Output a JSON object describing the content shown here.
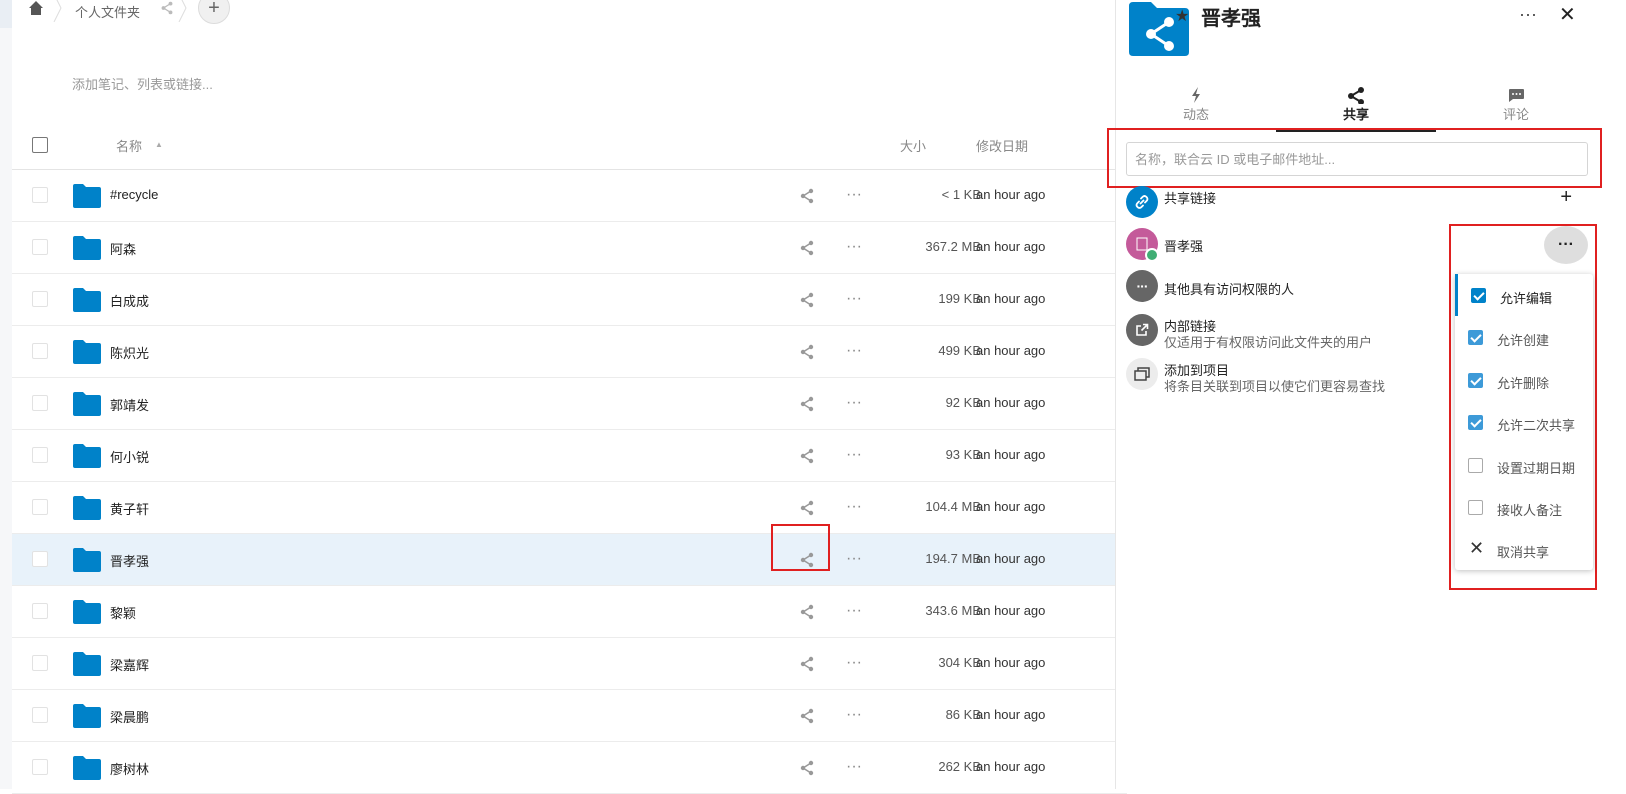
{
  "breadcrumb": {
    "label": "个人文件夹",
    "add_label": "+"
  },
  "notes_placeholder": "添加笔记、列表或链接...",
  "table": {
    "col_name": "名称",
    "col_size": "大小",
    "col_modified": "修改日期",
    "more_glyph": "···",
    "rows": [
      {
        "name": "#recycle",
        "size": "< 1 KB",
        "modified": "an hour ago"
      },
      {
        "name": "阿森",
        "size": "367.2 MB",
        "modified": "an hour ago"
      },
      {
        "name": "白成成",
        "size": "199 KB",
        "modified": "an hour ago"
      },
      {
        "name": "陈炽光",
        "size": "499 KB",
        "modified": "an hour ago"
      },
      {
        "name": "郭靖发",
        "size": "92 KB",
        "modified": "an hour ago"
      },
      {
        "name": "何小锐",
        "size": "93 KB",
        "modified": "an hour ago"
      },
      {
        "name": "黄子轩",
        "size": "104.4 MB",
        "modified": "an hour ago"
      },
      {
        "name": "晋孝强",
        "size": "194.7 MB",
        "modified": "an hour ago",
        "selected": true
      },
      {
        "name": "黎颖",
        "size": "343.6 MB",
        "modified": "an hour ago"
      },
      {
        "name": "梁嘉辉",
        "size": "304 KB",
        "modified": "an hour ago"
      },
      {
        "name": "梁晨鹏",
        "size": "86 KB",
        "modified": "an hour ago"
      },
      {
        "name": "廖树林",
        "size": "262 KB",
        "modified": "an hour ago"
      }
    ]
  },
  "sidebar": {
    "title": "晋孝强",
    "star_glyph": "★",
    "more_glyph": "···",
    "close_glyph": "✕",
    "tabs": [
      {
        "label": "动态",
        "icon": "lightning-icon"
      },
      {
        "label": "共享",
        "icon": "share-icon",
        "active": true
      },
      {
        "label": "评论",
        "icon": "comment-icon"
      }
    ],
    "search_placeholder": "名称，联合云 ID 或电子邮件地址...",
    "share_link": {
      "title": "共享链接",
      "add": "+"
    },
    "shared_user": {
      "name": "晋孝强",
      "more": "···"
    },
    "others": {
      "title": "其他具有访问权限的人"
    },
    "internal_link": {
      "title": "内部链接",
      "subtitle": "仅适用于有权限访问此文件夹的用户"
    },
    "project": {
      "title": "添加到项目",
      "subtitle": "将条目关联到项目以使它们更容易查找"
    },
    "menu": [
      {
        "label": "允许编辑",
        "checked": true
      },
      {
        "label": "允许创建",
        "checked": true
      },
      {
        "label": "允许删除",
        "checked": true
      },
      {
        "label": "允许二次共享",
        "checked": true
      },
      {
        "label": "设置过期日期",
        "checked": false
      },
      {
        "label": "接收人备注",
        "checked": false
      },
      {
        "label": "取消共享",
        "close": true,
        "glyph": "✕"
      }
    ]
  },
  "colors": {
    "accent": "#0082c9",
    "highlight": "#e02020",
    "selected_row": "#e8f2fa"
  }
}
